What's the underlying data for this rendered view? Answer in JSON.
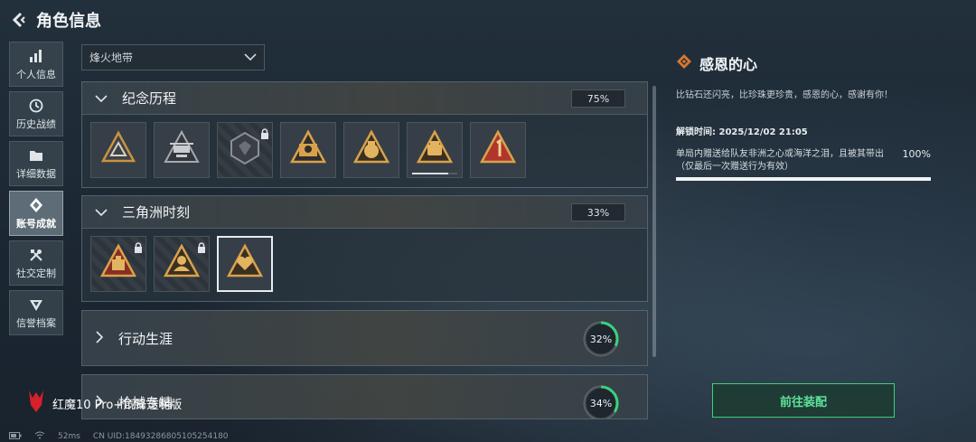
{
  "header": {
    "title": "角色信息",
    "back_icon": "chevron-left-icon"
  },
  "sidebar": {
    "items": [
      {
        "label": "个人信息",
        "icon": "bar-chart-icon",
        "active": false
      },
      {
        "label": "历史战绩",
        "icon": "history-clock-icon",
        "active": false
      },
      {
        "label": "详细数据",
        "icon": "folder-icon",
        "active": false
      },
      {
        "label": "账号成就",
        "icon": "achievement-icon",
        "active": true
      },
      {
        "label": "社交定制",
        "icon": "tools-icon",
        "active": false
      },
      {
        "label": "信誉档案",
        "icon": "shield-icon",
        "active": false
      }
    ]
  },
  "mode_select": {
    "value": "烽火地带"
  },
  "categories": [
    {
      "title": "纪念历程",
      "percent": "75%",
      "expanded": true
    },
    {
      "title": "三角洲时刻",
      "percent": "33%",
      "expanded": true
    },
    {
      "title": "行动生涯",
      "percent": "32%",
      "ring_progress": 0.32,
      "expanded": false
    },
    {
      "title": "枪械专精",
      "percent": "34%",
      "ring_progress": 0.34,
      "expanded": false
    }
  ],
  "badge_progress": 0.8,
  "detail": {
    "title": "感恩的心",
    "description": "比钻石还闪亮，比珍珠更珍贵，感恩的心，感谢有你！",
    "unlock_time": "解锁时间: 2025/12/02 21:05",
    "condition": "单局内赠送给队友非洲之心或海洋之泪，且被其带出（仅最后一次赠送行为有效）",
    "condition_percent": "100%",
    "condition_progress": 1.0
  },
  "equip_button": "前往装配",
  "watermark": "红魔10 Pro+氘锋透明版",
  "footer": {
    "ping": "52ms",
    "uid": "CN UID:18493286805105254180"
  },
  "colors": {
    "accent_green": "#3fd07a",
    "badge_orange": "#d9a24a",
    "badge_red": "#c0392b"
  }
}
